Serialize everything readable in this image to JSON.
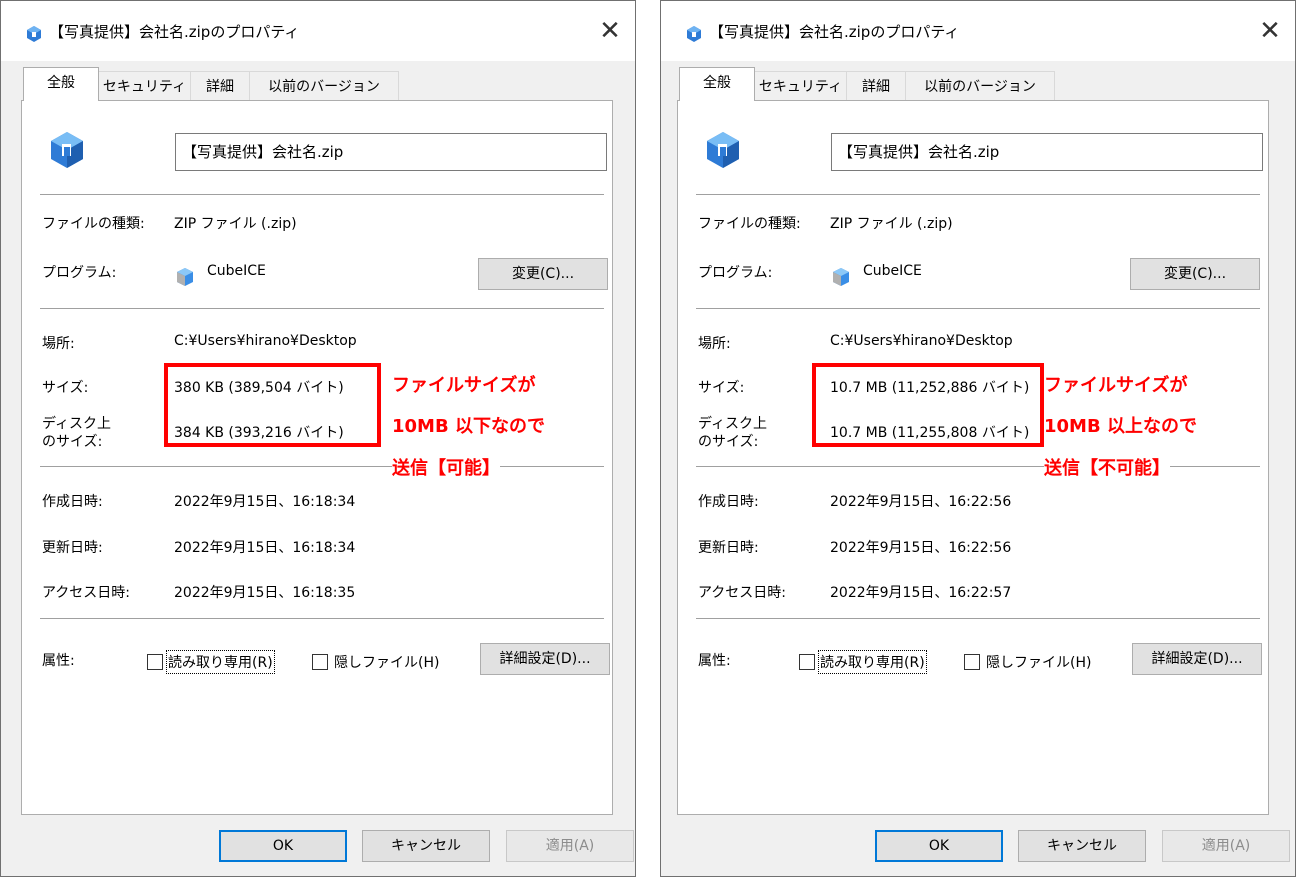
{
  "dialogs": [
    {
      "title": "【写真提供】会社名.zipのプロパティ",
      "close_glyph": "✕",
      "tabs": [
        "全般",
        "セキュリティ",
        "詳細",
        "以前のバージョン"
      ],
      "file_name": "【写真提供】会社名.zip",
      "labels": {
        "type": "ファイルの種類:",
        "program": "プログラム:",
        "location": "場所:",
        "size": "サイズ:",
        "disk_size_1": "ディスク上",
        "disk_size_2": "のサイズ:",
        "created": "作成日時:",
        "modified": "更新日時:",
        "accessed": "アクセス日時:",
        "attributes": "属性:"
      },
      "type_value": "ZIP ファイル (.zip)",
      "program_name": "CubeICE",
      "change_button": "変更(C)...",
      "location_value": "C:¥Users¥hirano¥Desktop",
      "size_value": "380 KB (389,504 バイト)",
      "disk_size_value": "384 KB (393,216 バイト)",
      "created_value": "2022年9月15日、16:18:34",
      "modified_value": "2022年9月15日、16:18:34",
      "accessed_value": "2022年9月15日、16:18:35",
      "readonly_label": "読み取り専用(R)",
      "readonly_checked": false,
      "hidden_label": "隠しファイル(H)",
      "hidden_checked": false,
      "advanced_button": "詳細設定(D)...",
      "ok_button": "OK",
      "cancel_button": "キャンセル",
      "apply_button": "適用(A)",
      "annotation": {
        "line1": "ファイルサイズが",
        "line2": "10MB 以下なので",
        "line3": "送信【可能】",
        "color": "#ff0000"
      }
    },
    {
      "title": "【写真提供】会社名.zipのプロパティ",
      "close_glyph": "✕",
      "tabs": [
        "全般",
        "セキュリティ",
        "詳細",
        "以前のバージョン"
      ],
      "file_name": "【写真提供】会社名.zip",
      "labels": {
        "type": "ファイルの種類:",
        "program": "プログラム:",
        "location": "場所:",
        "size": "サイズ:",
        "disk_size_1": "ディスク上",
        "disk_size_2": "のサイズ:",
        "created": "作成日時:",
        "modified": "更新日時:",
        "accessed": "アクセス日時:",
        "attributes": "属性:"
      },
      "type_value": "ZIP ファイル (.zip)",
      "program_name": "CubeICE",
      "change_button": "変更(C)...",
      "location_value": "C:¥Users¥hirano¥Desktop",
      "size_value": "10.7 MB (11,252,886 バイト)",
      "disk_size_value": "10.7 MB (11,255,808 バイト)",
      "created_value": "2022年9月15日、16:22:56",
      "modified_value": "2022年9月15日、16:22:56",
      "accessed_value": "2022年9月15日、16:22:57",
      "readonly_label": "読み取り専用(R)",
      "readonly_checked": false,
      "hidden_label": "隠しファイル(H)",
      "hidden_checked": false,
      "advanced_button": "詳細設定(D)...",
      "ok_button": "OK",
      "cancel_button": "キャンセル",
      "apply_button": "適用(A)",
      "annotation": {
        "line1": "ファイルサイズが",
        "line2": "10MB 以上なので",
        "line3": "送信【不可能】",
        "color": "#ff0000"
      }
    }
  ],
  "colors": {
    "dialog_bg": "#f0f0f0",
    "panel_bg": "#ffffff",
    "focus_blue": "#0078d7",
    "annotation_red": "#ff0000",
    "icon_blue": "#2e7bd6"
  }
}
